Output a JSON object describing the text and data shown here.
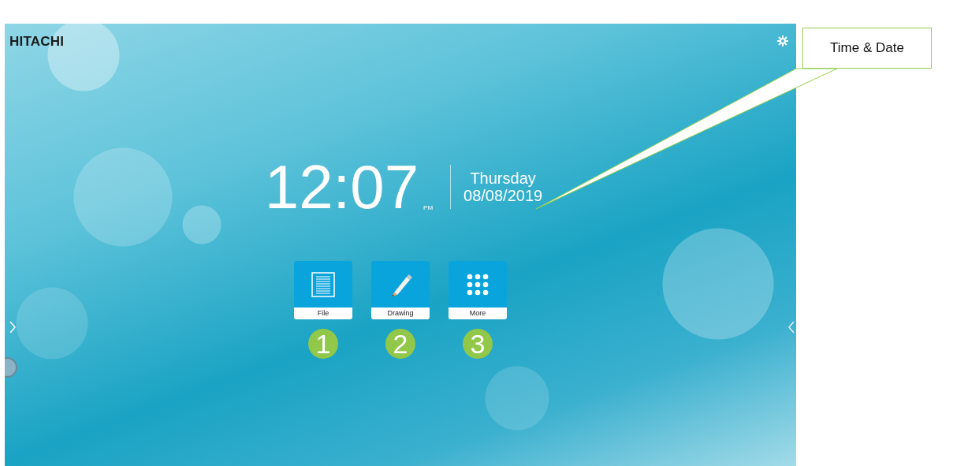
{
  "screen": {
    "logo": "HITACHI",
    "clock": {
      "time": "12:07",
      "meridiem": "PM",
      "day": "Thursday",
      "date": "08/08/2019"
    },
    "apps": [
      {
        "label": "File",
        "kind": "file",
        "marker": "1"
      },
      {
        "label": "Drawing",
        "kind": "drawing",
        "marker": "2"
      },
      {
        "label": "More",
        "kind": "more",
        "marker": "3"
      }
    ]
  },
  "callout": {
    "label": "Time & Date"
  }
}
